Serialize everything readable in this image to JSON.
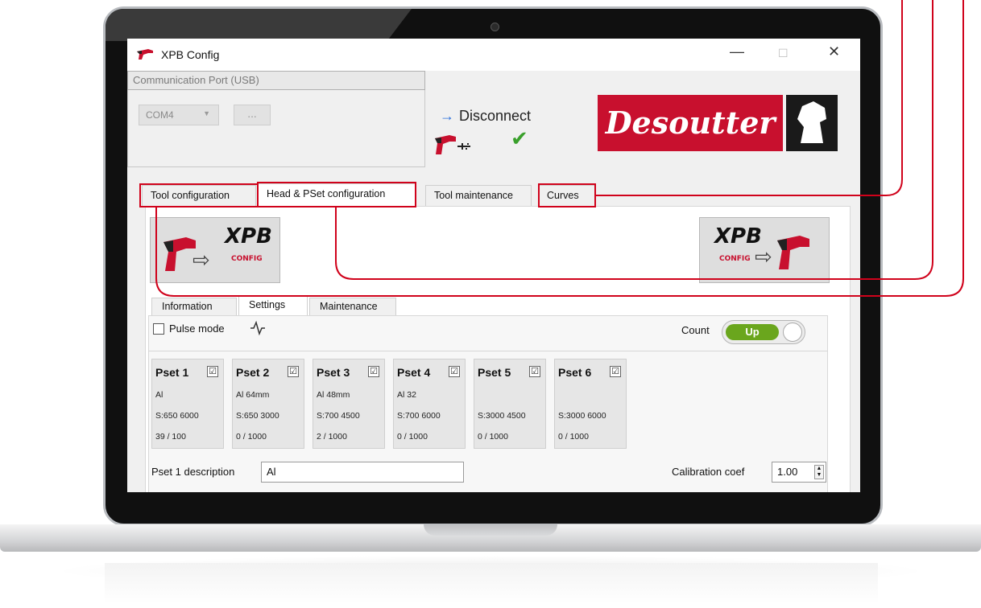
{
  "window": {
    "title": "XPB Config",
    "minimize": "—",
    "maximize": "☐",
    "close": "✕"
  },
  "comm": {
    "group_title": "Communication Port (USB)",
    "port": "COM4",
    "browse": "...",
    "disconnect": "Disconnect"
  },
  "brand": {
    "logo_text": "Desoutter",
    "accent": "#c8102e"
  },
  "tabs": [
    "Tool configuration",
    "Head & PSet configuration",
    "Tool maintenance",
    "Curves"
  ],
  "xpb": {
    "label": "XPB",
    "sub": "CONFIG"
  },
  "subtabs": [
    "Information",
    "Settings",
    "Maintenance"
  ],
  "settings": {
    "pulse_mode": "Pulse mode",
    "count_label": "Count",
    "count_value": "Up"
  },
  "psets": [
    {
      "name": "Pset 1",
      "checked": "☑",
      "desc": "Al",
      "speed": "S:650 6000",
      "count": "39 / 100"
    },
    {
      "name": "Pset 2",
      "checked": "☑",
      "desc": "Al 64mm",
      "speed": "S:650 3000",
      "count": "0 / 1000"
    },
    {
      "name": "Pset 3",
      "checked": "☑",
      "desc": "Al 48mm",
      "speed": "S:700 4500",
      "count": "2 / 1000"
    },
    {
      "name": "Pset 4",
      "checked": "☑",
      "desc": "Al 32",
      "speed": "S:700 6000",
      "count": "0 / 1000"
    },
    {
      "name": "Pset 5",
      "checked": "☑",
      "desc": "",
      "speed": "S:3000 4500",
      "count": "0 / 1000"
    },
    {
      "name": "Pset 6",
      "checked": "☑",
      "desc": "",
      "speed": "S:3000 6000",
      "count": "0 / 1000"
    }
  ],
  "description": {
    "label": "Pset 1 description",
    "value": "Al"
  },
  "calibration": {
    "label": "Calibration coef",
    "value": "1.00"
  }
}
